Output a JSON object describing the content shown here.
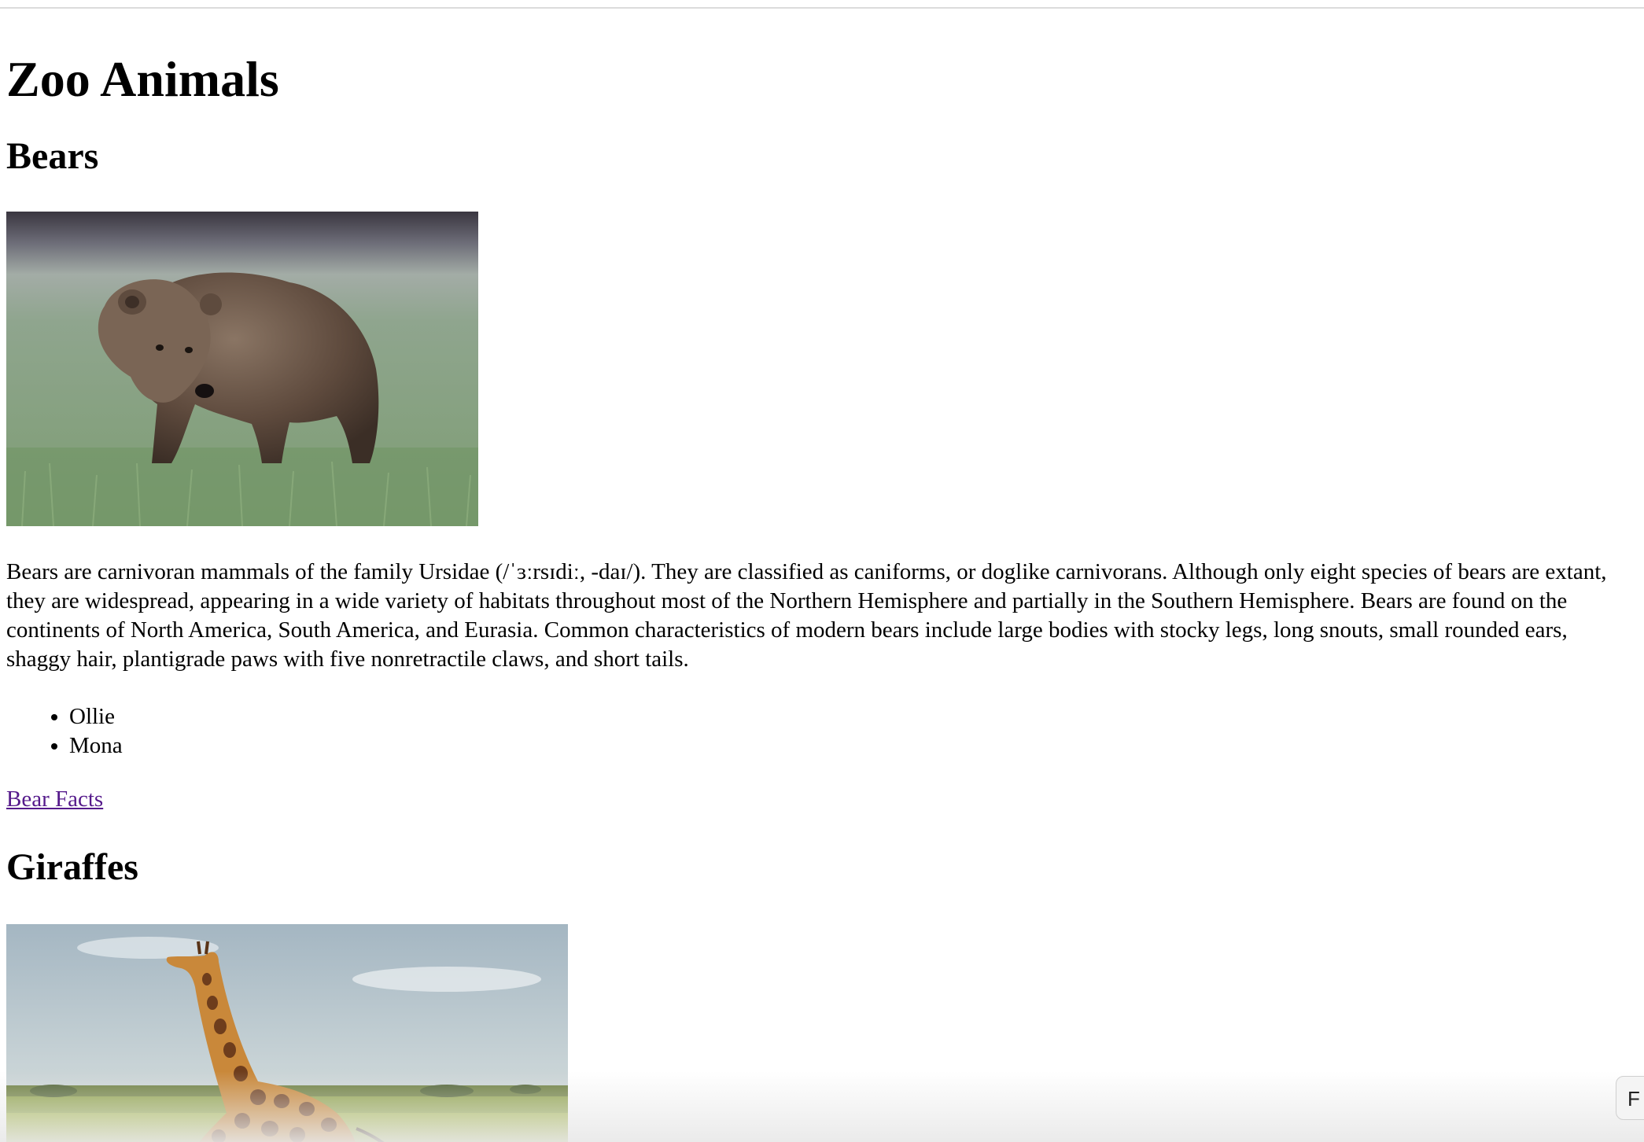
{
  "page": {
    "title": "Zoo Animals"
  },
  "sections": [
    {
      "title": "Bears",
      "image_alt": "Brown bear standing in a grassy field",
      "description": "Bears are carnivoran mammals of the family Ursidae (/ˈɜːrsɪdiː, -daɪ/). They are classified as caniforms, or doglike carnivorans. Although only eight species of bears are extant, they are widespread, appearing in a wide variety of habitats throughout most of the Northern Hemisphere and partially in the Southern Hemisphere. Bears are found on the continents of North America, South America, and Eurasia. Common characteristics of modern bears include large bodies with stocky legs, long snouts, small rounded ears, shaggy hair, plantigrade paws with five nonretractile claws, and short tails.",
      "names": [
        "Ollie",
        "Mona"
      ],
      "link_label": "Bear Facts"
    },
    {
      "title": "Giraffes",
      "image_alt": "Giraffe walking across the savanna"
    }
  ],
  "overlay": {
    "corner_button_label": "F"
  },
  "colors": {
    "visited_link": "#551a8b",
    "text": "#000000",
    "background": "#ffffff"
  }
}
